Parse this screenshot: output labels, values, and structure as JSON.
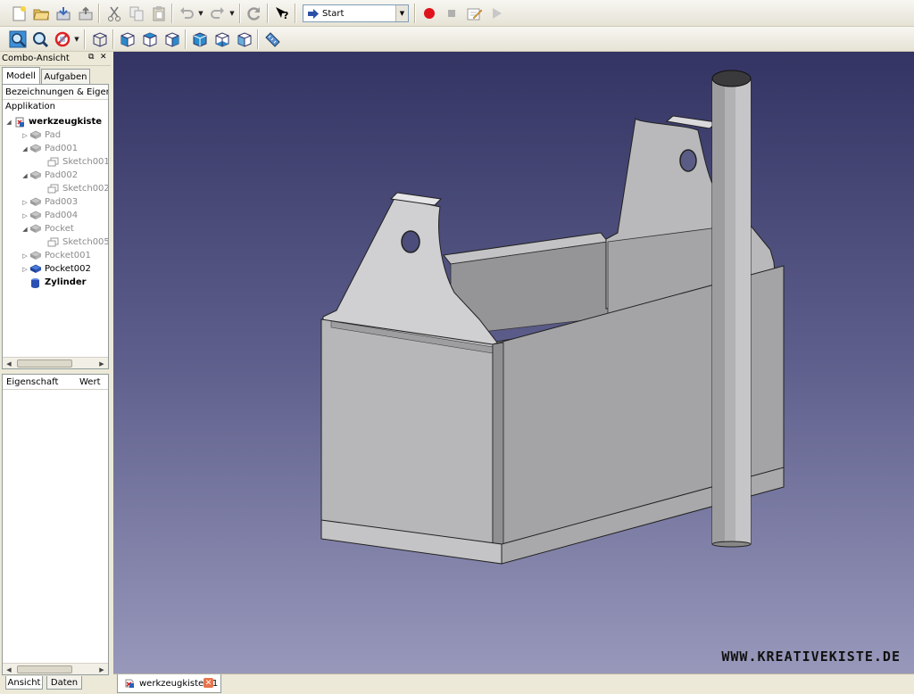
{
  "toolbar": {
    "macro_select": "Start"
  },
  "combo": {
    "title": "Combo-Ansicht",
    "tabs": [
      "Modell",
      "Aufgaben"
    ],
    "tree_header": "Bezeichnungen & Eigensc",
    "root_label": "Applikation",
    "document": "werkzeugkiste",
    "items": [
      {
        "label": "Pad",
        "type": "feature"
      },
      {
        "label": "Pad001",
        "type": "feature"
      },
      {
        "label": "Sketch001",
        "type": "sketch"
      },
      {
        "label": "Pad002",
        "type": "feature"
      },
      {
        "label": "Sketch002",
        "type": "sketch"
      },
      {
        "label": "Pad003",
        "type": "feature"
      },
      {
        "label": "Pad004",
        "type": "feature"
      },
      {
        "label": "Pocket",
        "type": "feature"
      },
      {
        "label": "Sketch005",
        "type": "sketch"
      },
      {
        "label": "Pocket001",
        "type": "feature"
      },
      {
        "label": "Pocket002",
        "type": "feature-active"
      },
      {
        "label": "Zylinder",
        "type": "cylinder"
      }
    ],
    "prop_header": {
      "property": "Eigenschaft",
      "value": "Wert"
    },
    "bottom_tabs": [
      "Ansicht",
      "Daten"
    ]
  },
  "viewport": {
    "watermark": "WWW.KREATIVEKISTE.DE"
  },
  "doc_tab": {
    "label": "werkzeugkiste : 1"
  },
  "colors": {
    "record": "#e0121b",
    "bg_top": "#333463",
    "bg_bottom": "#9898bb",
    "box": "#a9a9ab"
  }
}
